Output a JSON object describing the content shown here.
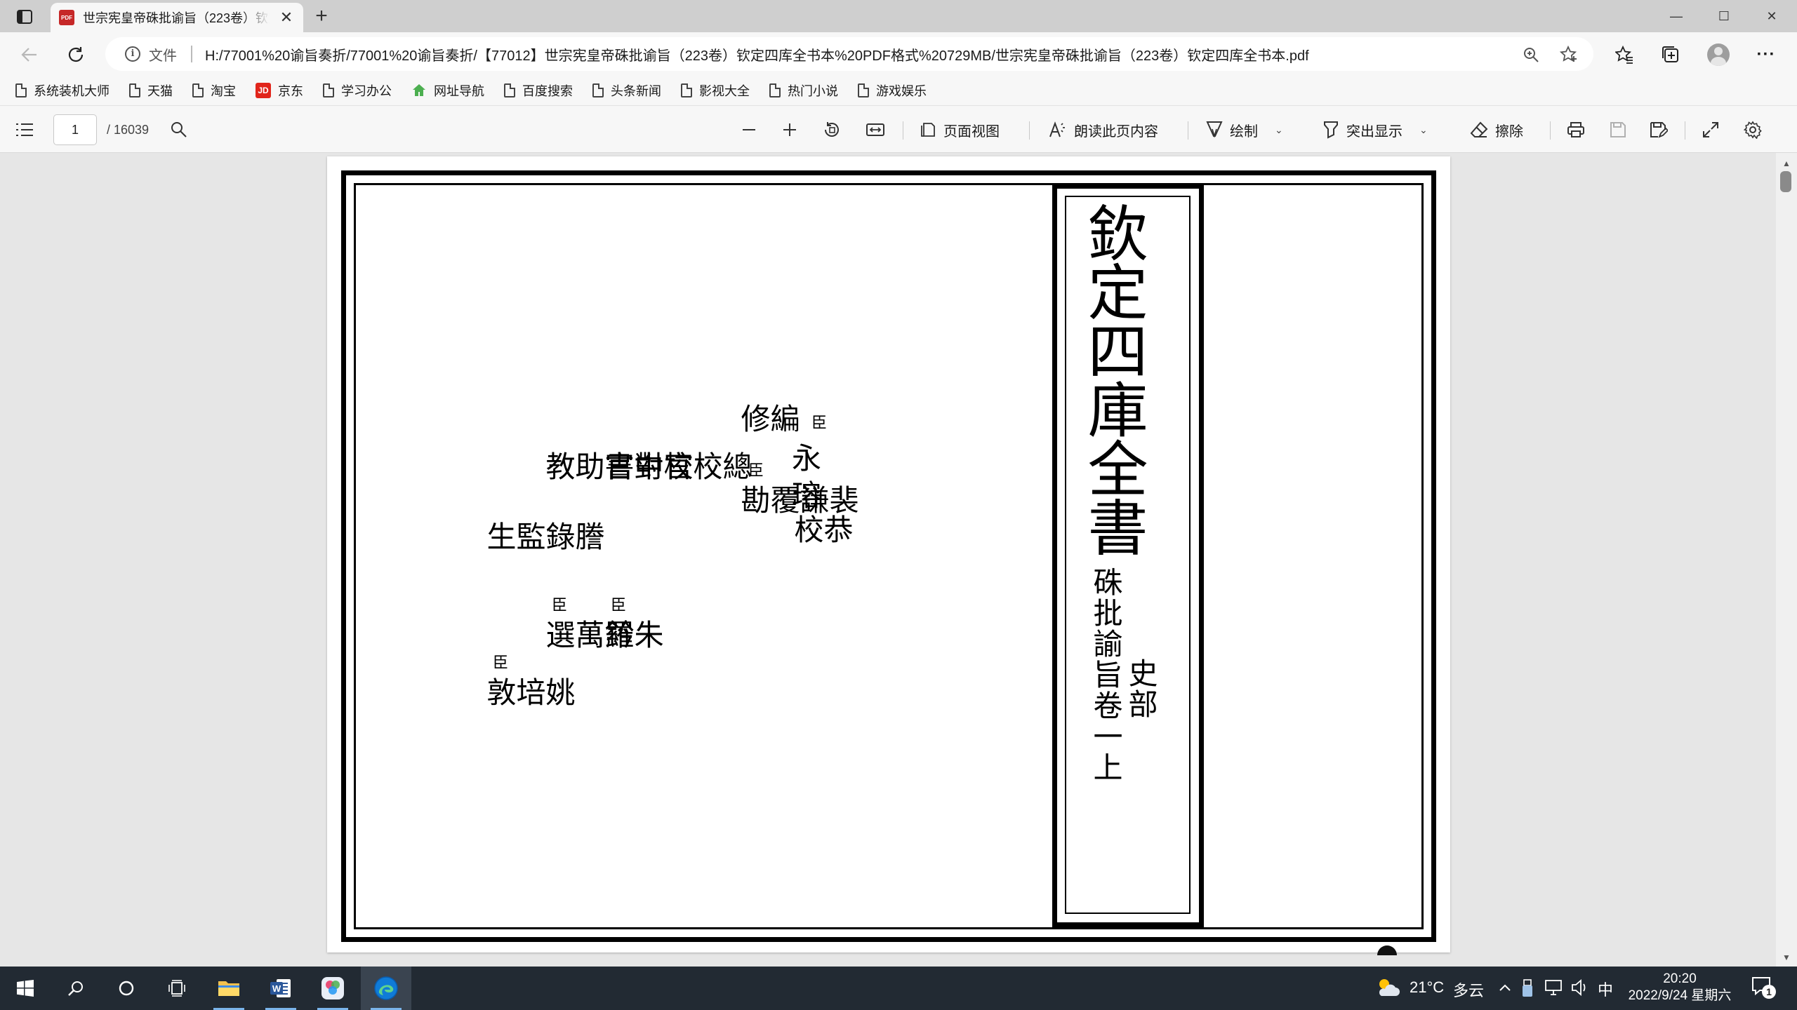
{
  "browser": {
    "tab": {
      "title": "世宗宪皇帝硃批谕旨（223卷）钦定四库全书本",
      "close_label": "✕"
    },
    "new_tab_label": "+",
    "window_controls": {
      "minimize": "—",
      "maximize": "☐",
      "close": "✕"
    },
    "address": {
      "scheme_label": "文件",
      "url": "H:/77001%20谕旨奏折/77001%20谕旨奏折/【77012】世宗宪皇帝硃批谕旨（223卷）钦定四库全书本%20PDF格式%20729MB/世宗宪皇帝硃批谕旨（223卷）钦定四库全书本.pdf"
    },
    "favorites": [
      {
        "label": "系统装机大师",
        "icon": "page-icon"
      },
      {
        "label": "天猫",
        "icon": "page-icon"
      },
      {
        "label": "淘宝",
        "icon": "page-icon"
      },
      {
        "label": "京东",
        "icon": "jd-icon"
      },
      {
        "label": "学习办公",
        "icon": "page-icon"
      },
      {
        "label": "网址导航",
        "icon": "nav-icon"
      },
      {
        "label": "百度搜索",
        "icon": "page-icon"
      },
      {
        "label": "头条新闻",
        "icon": "page-icon"
      },
      {
        "label": "影视大全",
        "icon": "page-icon"
      },
      {
        "label": "热门小说",
        "icon": "page-icon"
      },
      {
        "label": "游戏娱乐",
        "icon": "page-icon"
      }
    ]
  },
  "pdf_toolbar": {
    "current_page": "1",
    "total_pages": "/ 16039",
    "page_view_label": "页面视图",
    "read_aloud_label": "朗读此页内容",
    "draw_label": "绘制",
    "highlight_label": "突出显示",
    "erase_label": "擦除"
  },
  "document": {
    "book_title": "欽定四庫全書",
    "section_label": "史部",
    "subtitle": "硃批諭旨卷一上",
    "credits": {
      "minister_prefix": "臣",
      "yong": "永",
      "rong": "瑢",
      "gong_jiao": "恭校",
      "bian_xiu": "編修",
      "bian_xiu_name": "裴謙覆勘",
      "zong_jiao": "總校官中書",
      "zong_jiao_name": "朱鈐",
      "jiao_dui": "校對官助教",
      "jiao_dui_name": "羅萬選",
      "teng_lu": "謄錄監生",
      "teng_lu_name": "姚培敦"
    }
  },
  "taskbar": {
    "weather": {
      "temp": "21°C",
      "condition": "多云"
    },
    "ime": "中",
    "time": "20:20",
    "date": "2022/9/24 星期六",
    "notification_count": "1"
  },
  "colors": {
    "frame": "#000000",
    "taskbar": "#222a33",
    "pdf_tab_icon": "#c62828",
    "jd_red": "#e1251b",
    "edge_blue": "#0f7bd7"
  }
}
